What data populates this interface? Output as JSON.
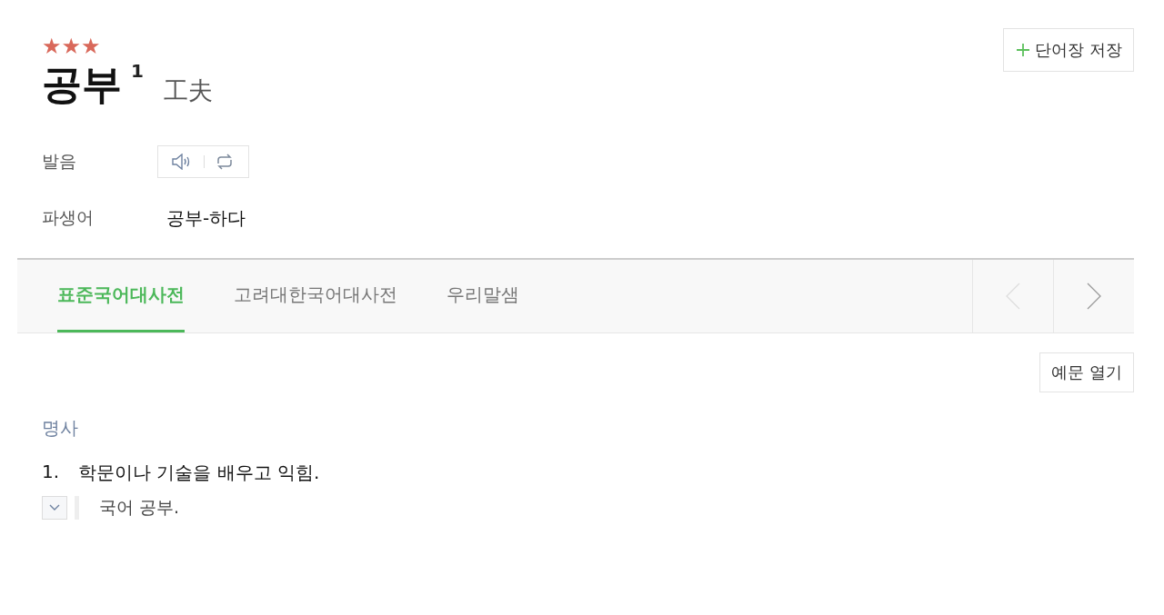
{
  "entry": {
    "stars": 3,
    "headword": "공부",
    "homonym_number": "1",
    "hanja": "工夫"
  },
  "save_button": {
    "label": "단어장 저장"
  },
  "info_rows": [
    {
      "kind": "audio",
      "label": "발음"
    },
    {
      "kind": "text",
      "label": "파생어",
      "value": "공부-하다"
    }
  ],
  "tabs": [
    {
      "label": "표준국어대사전",
      "selected": true
    },
    {
      "label": "고려대한국어대사전",
      "selected": false
    },
    {
      "label": "우리말샘",
      "selected": false
    }
  ],
  "tab_nav": {
    "prev_disabled": true,
    "next_disabled": false
  },
  "examples_button": {
    "label": "예문 열기"
  },
  "part_of_speech": "명사",
  "senses": [
    {
      "number": "1.",
      "definition": "학문이나 기술을 배우고 익힘.",
      "examples": [
        "국어 공부."
      ]
    }
  ]
}
